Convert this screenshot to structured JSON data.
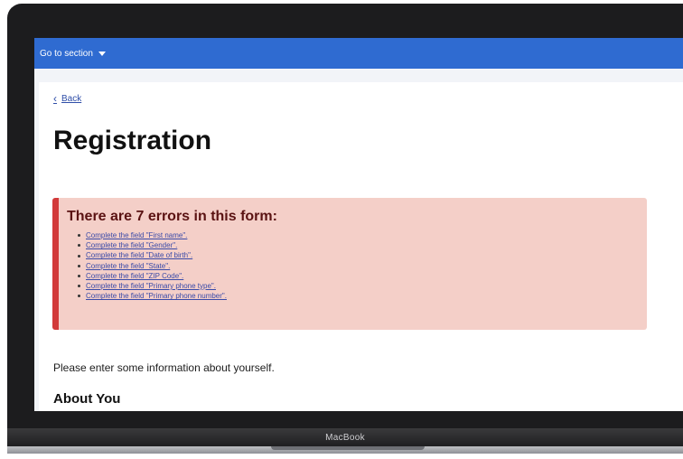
{
  "nav": {
    "goto_label": "Go to section"
  },
  "page": {
    "back_label": "Back",
    "title": "Registration",
    "intro": "Please enter some information about yourself.",
    "section_heading": "About You"
  },
  "error_summary": {
    "title": "There are 7 errors in this form:",
    "items": [
      "Complete the field \"First name\".",
      "Complete the field \"Gender\".",
      "Complete the field \"Date of birth\".",
      "Complete the field \"State\".",
      "Complete the field \"ZIP Code\".",
      "Complete the field \"Primary phone type\".",
      "Complete the field \"Primary phone number\"."
    ]
  },
  "device": {
    "brand": "MacBook"
  },
  "colors": {
    "topbar": "#2f6bd1",
    "error_bg": "#f4cfc8",
    "error_border": "#d23a3a",
    "link": "#2f4ea8"
  }
}
